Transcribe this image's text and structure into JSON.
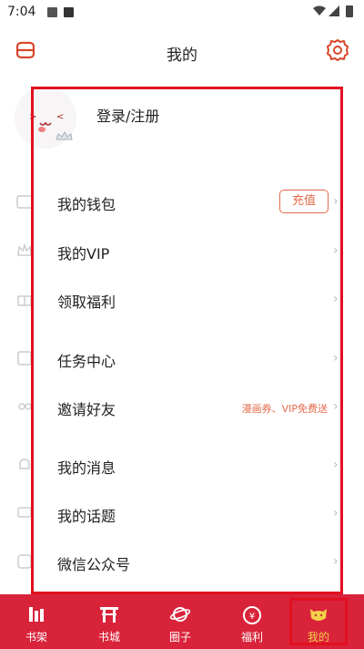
{
  "status_bar": {
    "time": "7:04"
  },
  "header": {
    "title": "我的"
  },
  "profile": {
    "login_label": "登录/注册"
  },
  "menu": [
    {
      "id": "wallet",
      "label": "我的钱包",
      "action_label": "充值"
    },
    {
      "id": "vip",
      "label": "我的VIP"
    },
    {
      "id": "benefits",
      "label": "领取福利"
    },
    {
      "id": "tasks",
      "label": "任务中心"
    },
    {
      "id": "invite",
      "label": "邀请好友",
      "hint": "漫画券、VIP免费送"
    },
    {
      "id": "messages",
      "label": "我的消息"
    },
    {
      "id": "topics",
      "label": "我的话题"
    },
    {
      "id": "wechat",
      "label": "微信公众号"
    }
  ],
  "tabbar": {
    "tabs": [
      {
        "id": "bookshelf",
        "label": "书架",
        "icon": "bookshelf-icon"
      },
      {
        "id": "bookstore",
        "label": "书城",
        "icon": "gate-icon"
      },
      {
        "id": "circle",
        "label": "圈子",
        "icon": "planet-icon"
      },
      {
        "id": "welfare",
        "label": "福利",
        "icon": "coin-bag-icon"
      },
      {
        "id": "mine",
        "label": "我的",
        "icon": "cat-face-icon",
        "selected": true
      }
    ]
  },
  "colors": {
    "accent": "#e56a4a",
    "tabbar_bg": "#d9233a",
    "highlight": "#e11020"
  }
}
